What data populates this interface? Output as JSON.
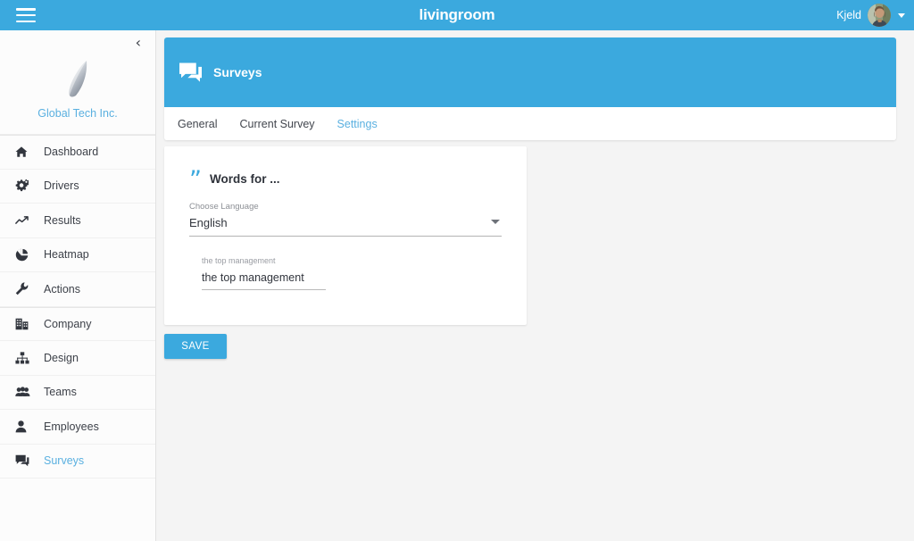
{
  "topbar": {
    "menu_icon": "hamburger-menu-icon",
    "brand": "livingroom",
    "user_name": "Kjeld",
    "avatar_icon": "user-avatar-photo",
    "caret_icon": "chevron-down-icon",
    "background_color": "#3ba9de"
  },
  "sidebar": {
    "collapse_icon": "chevron-left-icon",
    "collapse_glyph": "‹",
    "org_logo_icon": "feather-logo-icon",
    "org_name": "Global Tech Inc.",
    "accent_color": "#5ab0e0",
    "items": [
      {
        "label": "Dashboard",
        "icon": "home-icon",
        "active": false,
        "group_start": true
      },
      {
        "label": "Drivers",
        "icon": "gears-icon",
        "active": false,
        "group_start": false
      },
      {
        "label": "Results",
        "icon": "trending-up-icon",
        "active": false,
        "group_start": false
      },
      {
        "label": "Heatmap",
        "icon": "pie-chart-icon",
        "active": false,
        "group_start": false
      },
      {
        "label": "Actions",
        "icon": "wrench-icon",
        "active": false,
        "group_start": false
      },
      {
        "label": "Company",
        "icon": "building-icon",
        "active": false,
        "group_start": true
      },
      {
        "label": "Design",
        "icon": "sitemap-icon",
        "active": false,
        "group_start": false
      },
      {
        "label": "Teams",
        "icon": "people-group-icon",
        "active": false,
        "group_start": false
      },
      {
        "label": "Employees",
        "icon": "person-icon",
        "active": false,
        "group_start": false
      },
      {
        "label": "Surveys",
        "icon": "chat-bubbles-icon",
        "active": true,
        "group_start": false
      }
    ]
  },
  "panel": {
    "banner_icon": "chat-bubbles-icon",
    "banner_title": "Surveys",
    "banner_color": "#3ba9de",
    "tabs": [
      {
        "label": "General",
        "active": false
      },
      {
        "label": "Current Survey",
        "active": false
      },
      {
        "label": "Settings",
        "active": true
      }
    ]
  },
  "card": {
    "quote_icon": "quotation-mark-icon",
    "quote_glyph": "”",
    "title": "Words for ...",
    "language_field": {
      "label": "Choose Language",
      "value": "English",
      "arrow_icon": "dropdown-arrow-icon"
    },
    "text_field": {
      "label": "the top management",
      "value": "the top management",
      "placeholder": "the top management"
    }
  },
  "actions": {
    "save_label": "SAVE"
  }
}
